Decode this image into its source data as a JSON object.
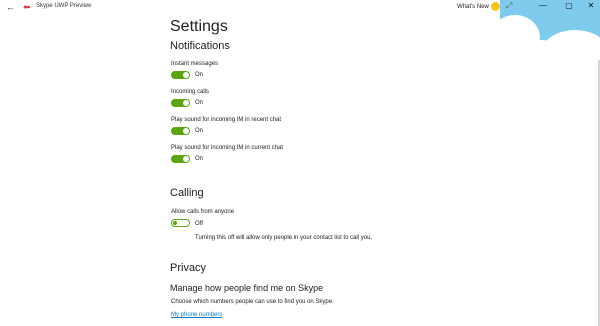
{
  "titlebar": {
    "back_icon": "back-arrow-icon",
    "app_icon": "skype-icon",
    "app_title": "Skype UWP Preview",
    "whats_new": "What's New",
    "emoji_icon": "smiley-icon",
    "expand_icon": "expand-icon",
    "minimize": "—",
    "maximize": "▢",
    "close": "✕"
  },
  "settings": {
    "title": "Settings",
    "notifications": {
      "heading": "Notifications",
      "items": [
        {
          "label": "Instant messages",
          "state": "On"
        },
        {
          "label": "Incoming calls",
          "state": "On"
        },
        {
          "label": "Play sound for incoming IM in recent chat",
          "state": "On"
        },
        {
          "label": "Play sound for incoming IM in current chat",
          "state": "On"
        }
      ]
    },
    "calling": {
      "heading": "Calling",
      "allow_label": "Allow calls from anyone",
      "allow_state": "Off",
      "allow_hint": "Turning this off will allow only people in your contact list to call you."
    },
    "privacy": {
      "heading": "Privacy",
      "subheading": "Manage how people find me on Skype",
      "description": "Choose which numbers people can use to find you on Skype.",
      "link": "My phone numbers"
    }
  },
  "colors": {
    "toggle_on": "#5ba60e",
    "link": "#0b7ac4",
    "sky": "#7ecbee",
    "brand": "#e8374b"
  }
}
